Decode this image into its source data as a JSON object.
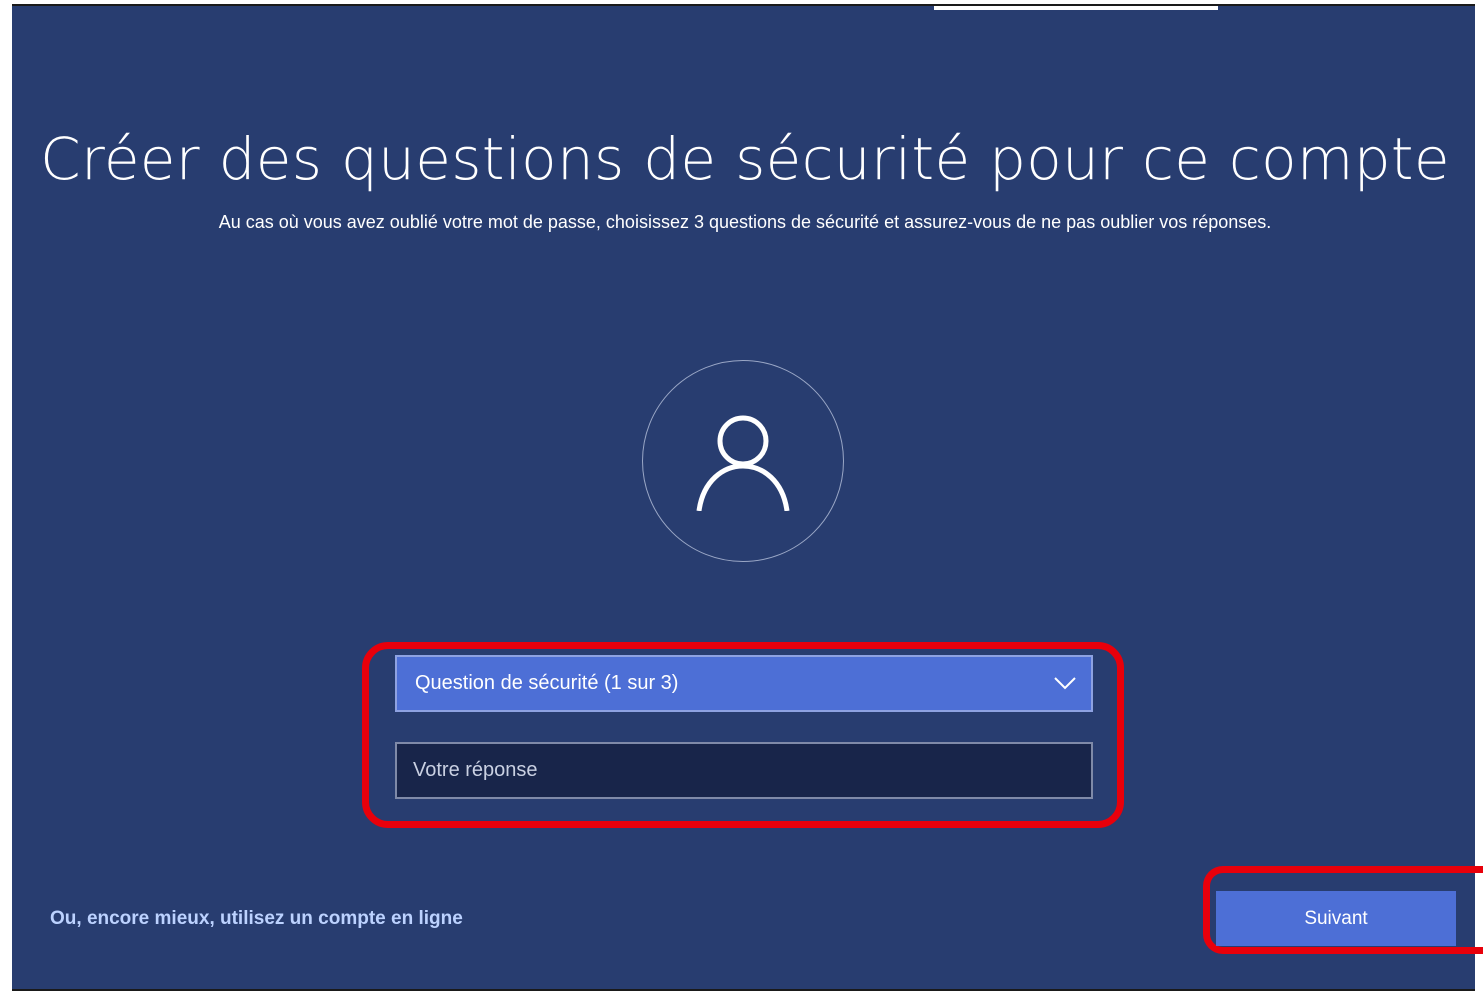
{
  "page": {
    "title": "Créer des questions de sécurité pour ce compte",
    "subtitle": "Au cas où vous avez oublié votre mot de passe, choisissez 3 questions de sécurité et assurez-vous de ne pas oublier vos réponses."
  },
  "avatar": {
    "icon": "user-icon"
  },
  "form": {
    "question_select": {
      "selected": "Question de sécurité (1 sur 3)",
      "icon": "chevron-down-icon"
    },
    "answer_field": {
      "placeholder": "Votre réponse",
      "value": ""
    }
  },
  "footer": {
    "online_account_link": "Ou, encore mieux, utilisez un compte en ligne",
    "next_button": "Suivant"
  },
  "colors": {
    "background": "#283d70",
    "accent": "#4d6fd6",
    "input_background": "#18254a",
    "highlight": "#e8000b",
    "link": "#bcd2ff"
  }
}
